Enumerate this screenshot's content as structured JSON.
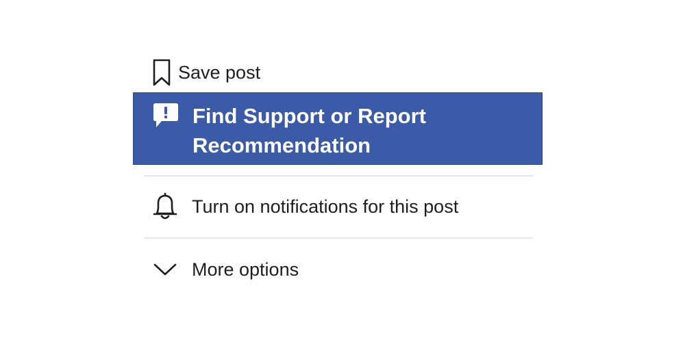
{
  "menu": {
    "items": [
      {
        "label": "Save post",
        "icon": "bookmark-icon"
      },
      {
        "label": "Find Support or Report Recommendation",
        "icon": "report-flag-icon",
        "highlighted": true
      },
      {
        "label": "Turn on notifications for this post",
        "icon": "bell-icon"
      },
      {
        "label": "More options",
        "icon": "chevron-down-icon"
      }
    ]
  },
  "colors": {
    "highlight_background": "#3b5ba9",
    "highlight_text": "#ffffff",
    "text": "#1c1e21",
    "divider": "#e4e6ea"
  }
}
